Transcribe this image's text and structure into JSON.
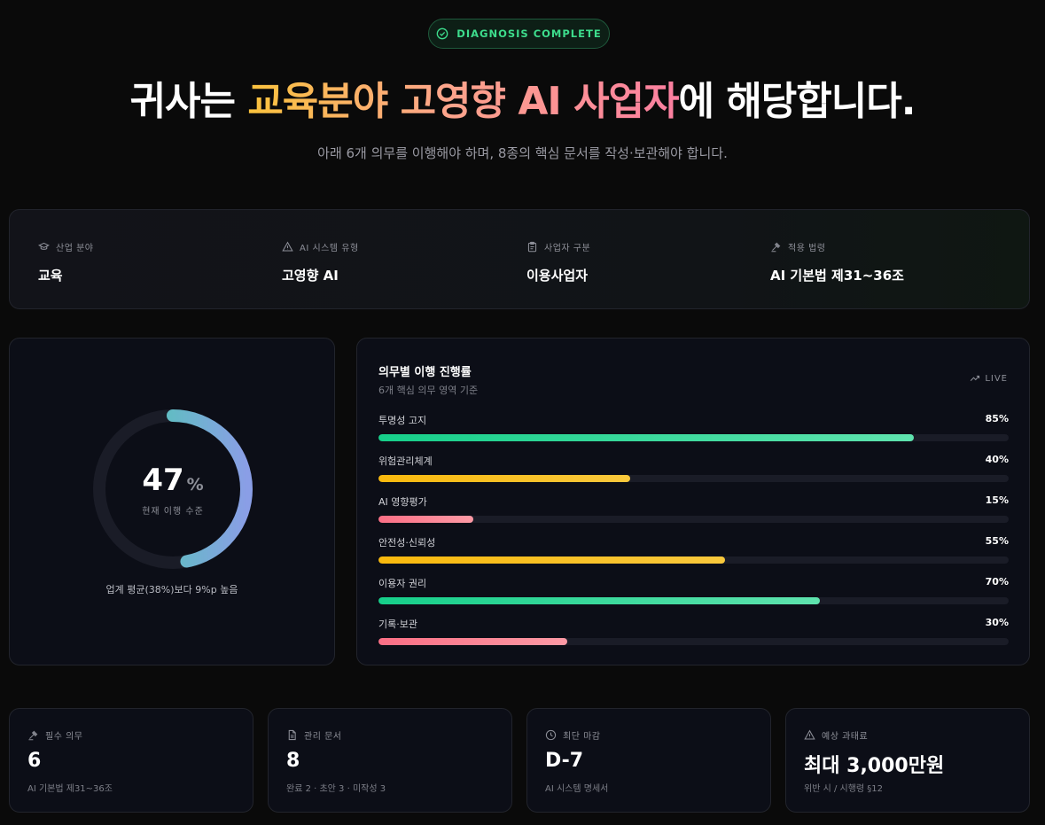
{
  "badge": {
    "text": "DIAGNOSIS COMPLETE",
    "icon": "check-circle-icon",
    "color": "#3ddc8c"
  },
  "headline": {
    "prefix": "귀사는 ",
    "highlight": "교육분야 고영향 AI 사업자",
    "suffix": "에 해당합니다."
  },
  "subheadline": "아래 6개 의무를 이행해야 하며, 8종의 핵심 문서를 작성·보관해야 합니다.",
  "info": [
    {
      "icon": "graduation-cap-icon",
      "label": "산업 분야",
      "value": "교육"
    },
    {
      "icon": "warning-triangle-icon",
      "label": "AI 시스템 유형",
      "value": "고영향 AI"
    },
    {
      "icon": "clipboard-icon",
      "label": "사업자 구분",
      "value": "이용사업자"
    },
    {
      "icon": "gavel-icon",
      "label": "적용 법령",
      "value": "AI 기본법 제31~36조"
    }
  ],
  "gauge": {
    "value": 47,
    "unit": "%",
    "caption": "현재 이행 수준",
    "note": "업계 평균(38%)보다 9%p 높음"
  },
  "progress": {
    "title": "의무별 이행 진행률",
    "subtitle": "6개 핵심 의무 영역 기준",
    "live_label": "LIVE",
    "items": [
      {
        "label": "투명성 고지",
        "value": 85,
        "value_label": "85%",
        "color_from": "#16cf8a",
        "color_to": "#5fe3ae"
      },
      {
        "label": "위험관리체계",
        "value": 40,
        "value_label": "40%",
        "color_from": "#f9b90d",
        "color_to": "#f9c83c"
      },
      {
        "label": "AI 영향평가",
        "value": 15,
        "value_label": "15%",
        "color_from": "#fb6f85",
        "color_to": "#fd9aa5"
      },
      {
        "label": "안전성·신뢰성",
        "value": 55,
        "value_label": "55%",
        "color_from": "#f9b90d",
        "color_to": "#f9c83c"
      },
      {
        "label": "이용자 권리",
        "value": 70,
        "value_label": "70%",
        "color_from": "#16cf8a",
        "color_to": "#5fe3ae"
      },
      {
        "label": "기록·보관",
        "value": 30,
        "value_label": "30%",
        "color_from": "#fb6f85",
        "color_to": "#fd9aa5"
      }
    ]
  },
  "stats": [
    {
      "icon": "gavel-icon",
      "label": "필수 의무",
      "value": "6",
      "sub": "AI 기본법 제31~36조"
    },
    {
      "icon": "document-icon",
      "label": "관리 문서",
      "value": "8",
      "sub": "완료 2 · 초안 3 · 미작성 3"
    },
    {
      "icon": "clock-icon",
      "label": "최단 마감",
      "value": "D-7",
      "sub": "AI 시스템 명세서"
    },
    {
      "icon": "warning-triangle-icon",
      "label": "예상 과태료",
      "value": "최대 3,000만원",
      "sub": "위반 시 / 시행령 §12"
    }
  ]
}
